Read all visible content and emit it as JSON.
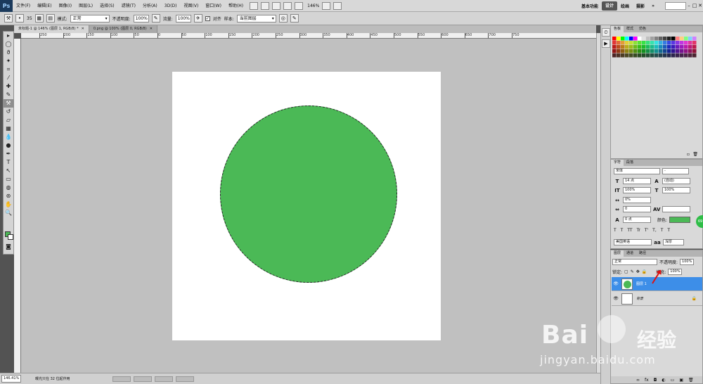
{
  "app": {
    "logo": "Ps",
    "menus": [
      "文件(F)",
      "编辑(E)",
      "图像(I)",
      "图层(L)",
      "选择(S)",
      "滤镜(T)",
      "分析(A)",
      "3D(D)",
      "视图(V)",
      "窗口(W)",
      "帮助(H)"
    ],
    "zoom": "146%",
    "workspaces": [
      {
        "label": "基本功能",
        "active": false
      },
      {
        "label": "设计",
        "active": true
      },
      {
        "label": "绘画",
        "active": false
      },
      {
        "label": "摄影",
        "active": false
      }
    ],
    "more": "»",
    "window_buttons": [
      "–",
      "□",
      "✕"
    ]
  },
  "options": {
    "brush_size": "35",
    "mode_label": "模式:",
    "mode_value": "正常",
    "opacity_label": "不透明度:",
    "opacity_value": "100%",
    "flow_label": "流量:",
    "flow_value": "100%",
    "aligned_label": "对齐",
    "sample_label": "样本:",
    "sample_value": "当前图层"
  },
  "tabs": [
    {
      "label": "未标题-1 @ 146% (图层 1, RGB/8) *",
      "active": true
    },
    {
      "label": "0.png @ 100% (图层 0, RGB/8)",
      "active": false
    }
  ],
  "ruler_labels": [
    "250",
    "200",
    "150",
    "100",
    "50",
    "0",
    "50",
    "100",
    "150",
    "200",
    "250",
    "300",
    "350",
    "400",
    "450",
    "500",
    "550",
    "600",
    "650",
    "700",
    "750"
  ],
  "status": {
    "zoom": "146.41%",
    "info": "曝光只在 32 位起作用"
  },
  "colors": {
    "fill": "#4bb956",
    "foreground": "#4bb956",
    "background": "#ffffff",
    "selected_layer": "#3d8ee8"
  },
  "swatches_panel": {
    "tabs": [
      "色板",
      "样式",
      "仿色"
    ]
  },
  "character_panel": {
    "tabs": [
      "字符",
      "段落"
    ],
    "font_family": "宋体",
    "font_style": "-",
    "font_size": "14 点",
    "leading": "(自动)",
    "vertical_scale": "100%",
    "horizontal_scale": "100%",
    "baseline_pct": "0%",
    "tracking": "0",
    "baseline_shift": "0 点",
    "color_label": "颜色:",
    "style_buttons": [
      "T",
      "T",
      "TT",
      "Tr",
      "T'",
      "T,",
      "T",
      "T"
    ],
    "language": "美国英语",
    "antialias_icon": "aa",
    "antialias": "浑厚"
  },
  "layers_panel": {
    "tabs": [
      "图层",
      "通道",
      "路径"
    ],
    "blend_mode": "正常",
    "opacity_label": "不透明度:",
    "opacity_value": "100%",
    "lock_label": "锁定:",
    "fill_label": "填充:",
    "fill_value": "100%",
    "layers": [
      {
        "name": "图层 1",
        "selected": true
      },
      {
        "name": "背景",
        "selected": false
      }
    ],
    "bottom_icons": [
      "∞",
      "fx",
      "◘",
      "◐",
      "▭",
      "▣",
      "🗑"
    ]
  },
  "side_bubble": "69",
  "watermark": {
    "main": "Bai",
    "cn": "经验",
    "sub": "jingyan.baidu.com"
  }
}
